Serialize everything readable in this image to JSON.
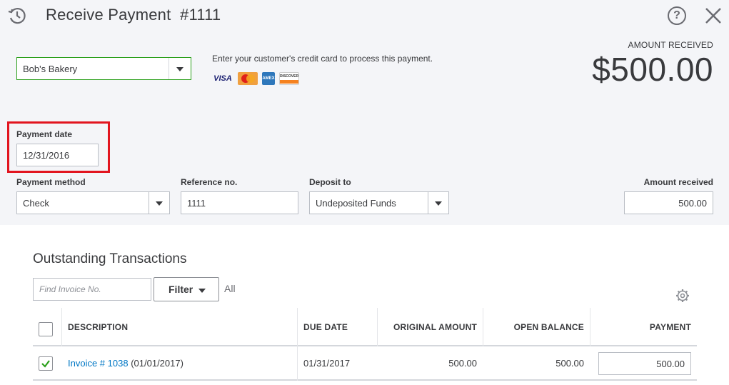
{
  "header": {
    "title": "Receive Payment",
    "number": "#1111",
    "icons": {
      "history": "history-icon",
      "help": "help-icon",
      "close": "close-icon"
    }
  },
  "customer": {
    "value": "Bob's Bakery"
  },
  "credit_card": {
    "text": "Enter your customer's credit card to process this payment.",
    "cards": [
      "VISA",
      "MasterCard",
      "AMEX",
      "DISCOVER"
    ]
  },
  "amount_received_header": {
    "label": "AMOUNT RECEIVED",
    "value": "$500.00"
  },
  "payment_date": {
    "label": "Payment date",
    "value": "12/31/2016"
  },
  "payment_method": {
    "label": "Payment method",
    "value": "Check"
  },
  "reference_no": {
    "label": "Reference no.",
    "value": "1111"
  },
  "deposit_to": {
    "label": "Deposit to",
    "value": "Undeposited Funds"
  },
  "amount_received_field": {
    "label": "Amount received",
    "value": "500.00"
  },
  "outstanding": {
    "title": "Outstanding Transactions",
    "find_placeholder": "Find Invoice No.",
    "filter_label": "Filter",
    "all_label": "All",
    "columns": [
      "DESCRIPTION",
      "DUE DATE",
      "ORIGINAL AMOUNT",
      "OPEN BALANCE",
      "PAYMENT"
    ],
    "rows": [
      {
        "checked": true,
        "invoice_link": "Invoice # 1038",
        "invoice_date": "(01/01/2017)",
        "due_date": "01/31/2017",
        "original_amount": "500.00",
        "open_balance": "500.00",
        "payment": "500.00"
      }
    ]
  },
  "colors": {
    "accent_green": "#2ca01c",
    "link_blue": "#0077c5",
    "highlight_red": "#e2151f",
    "top_bg": "#f4f5f8"
  }
}
